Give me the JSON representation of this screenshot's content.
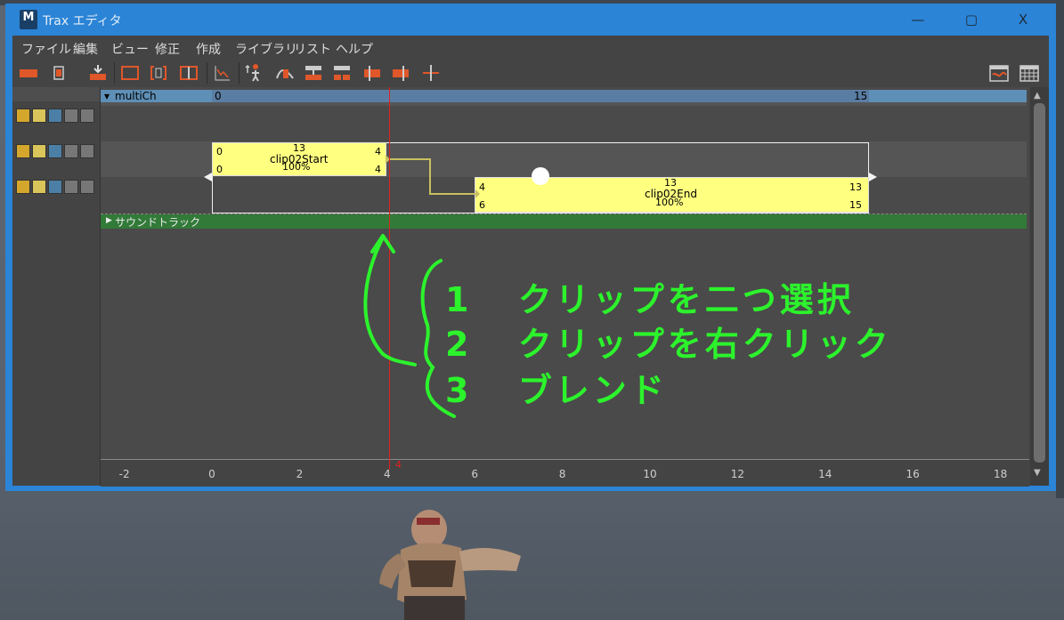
{
  "window": {
    "title": "Trax エディタ",
    "app_icon_letter": "M",
    "controls": [
      "—",
      "▢",
      "X"
    ]
  },
  "menu": [
    "ファイル",
    "編集",
    "ビュー",
    "修正",
    "作成",
    "ライブラリ",
    "リスト",
    "ヘルプ"
  ],
  "toolbar_icons": [
    "clip-icon",
    "track-icon",
    "load-icon",
    "frame-all-icon",
    "frame-playback-icon",
    "frame-selection-icon",
    "graph-icon",
    "character-icon",
    "blend-icon",
    "merge-icon",
    "split-icon",
    "trim-before-icon",
    "trim-after-icon",
    "time-marker-icon",
    "camera-sequencer-icon",
    "grid-icon"
  ],
  "character": {
    "name": "multiCh",
    "start_label": "0",
    "end_label": "15"
  },
  "clips": [
    {
      "name": "clip02Start",
      "top_left": "0",
      "top_mid": "13",
      "top_right": "4",
      "bottom_left": "0",
      "scale": "100%",
      "bottom_right": "4",
      "start": 0,
      "end": 4
    },
    {
      "name": "clip02End",
      "top_left": "4",
      "top_mid": "13",
      "top_right": "13",
      "bottom_left": "6",
      "scale": "100%",
      "bottom_right": "15",
      "start": 6,
      "end": 15
    }
  ],
  "sound_track": {
    "label": "サウンドトラック"
  },
  "ruler_ticks": [
    "-2",
    "0",
    "2",
    "4",
    "6",
    "8",
    "10",
    "12",
    "14",
    "16",
    "18"
  ],
  "current_time": 4,
  "annotations": {
    "line1_num": "1",
    "line1_text": "クリップを二つ選択",
    "line2_num": "2",
    "line2_text": "クリップを右クリック",
    "line3_num": "3",
    "line3_text": "ブレンド"
  },
  "colors": {
    "clip": "#ffff80",
    "annotation": "#2cf32c",
    "time_marker": "#e02020",
    "sound_track": "#327a38",
    "title_bar": "#2b84d6"
  }
}
